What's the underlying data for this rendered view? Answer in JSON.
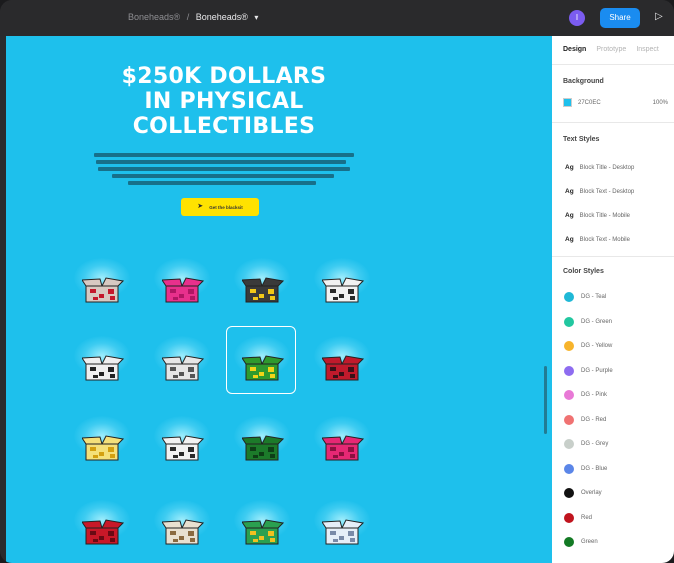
{
  "topbar": {
    "project": "Boneheads®",
    "file": "Boneheads®",
    "avatar_initial": "I",
    "share_label": "Share",
    "play_icon": "play-icon"
  },
  "hero": {
    "title_lines": [
      "$250K DOLLARS",
      "IN PHYSICAL",
      "COLLECTIBLES"
    ],
    "cta_label": "Get the blacksit",
    "cta_icon": "send-icon"
  },
  "panel": {
    "tabs": [
      "Design",
      "Prototype",
      "Inspect"
    ],
    "background": {
      "heading": "Background",
      "hex": "27C0EC",
      "opacity": "100%",
      "color": "#1ec0ec"
    },
    "text_styles": {
      "heading": "Text Styles",
      "items": [
        {
          "ag": "Ag",
          "label": "Block Title - Desktop"
        },
        {
          "ag": "Ag",
          "label": "Block Text - Desktop"
        },
        {
          "ag": "Ag",
          "label": "Block Title - Mobile"
        },
        {
          "ag": "Ag",
          "label": "Block Text - Mobile"
        }
      ]
    },
    "color_styles": {
      "heading": "Color Styles",
      "items": [
        {
          "label": "DG - Teal",
          "color": "#1fb8d6"
        },
        {
          "label": "DG - Green",
          "color": "#22c7a0"
        },
        {
          "label": "DG - Yellow",
          "color": "#f7b42c"
        },
        {
          "label": "DG - Purple",
          "color": "#8e6cf0"
        },
        {
          "label": "DG - Pink",
          "color": "#e879d6"
        },
        {
          "label": "DG - Red",
          "color": "#f07272"
        },
        {
          "label": "DG - Grey",
          "color": "#c8cfca"
        },
        {
          "label": "DG - Blue",
          "color": "#5b86e8"
        },
        {
          "label": "Overlay",
          "color": "#111111"
        },
        {
          "label": "Red",
          "color": "#c0141e"
        },
        {
          "label": "Green",
          "color": "#137a24"
        }
      ]
    }
  },
  "grid": {
    "boxes": [
      {
        "color": "#d8c9c2",
        "pattern": "#c4182c"
      },
      {
        "color": "#e8308c",
        "pattern": "#b01664"
      },
      {
        "color": "#3a3a3a",
        "pattern": "#f2c818"
      },
      {
        "color": "#f2f2f2",
        "pattern": "#2a2a2a"
      },
      {
        "color": "#efefef",
        "pattern": "#222222"
      },
      {
        "color": "#e6e6e6",
        "pattern": "#555555"
      },
      {
        "color": "#2f9a2e",
        "pattern": "#f2d418"
      },
      {
        "color": "#c01a2c",
        "pattern": "#3a1018"
      },
      {
        "color": "#f4e07a",
        "pattern": "#d4a010"
      },
      {
        "color": "#f2f2f2",
        "pattern": "#2a2a2a"
      },
      {
        "color": "#1c7a2a",
        "pattern": "#0e3e16"
      },
      {
        "color": "#e62874",
        "pattern": "#8c1040"
      },
      {
        "color": "#c81828",
        "pattern": "#6a0a14"
      },
      {
        "color": "#e8e0d0",
        "pattern": "#8a6a40"
      },
      {
        "color": "#2aa050",
        "pattern": "#f0c020"
      },
      {
        "color": "#e6eef8",
        "pattern": "#7a8aa8"
      }
    ]
  }
}
